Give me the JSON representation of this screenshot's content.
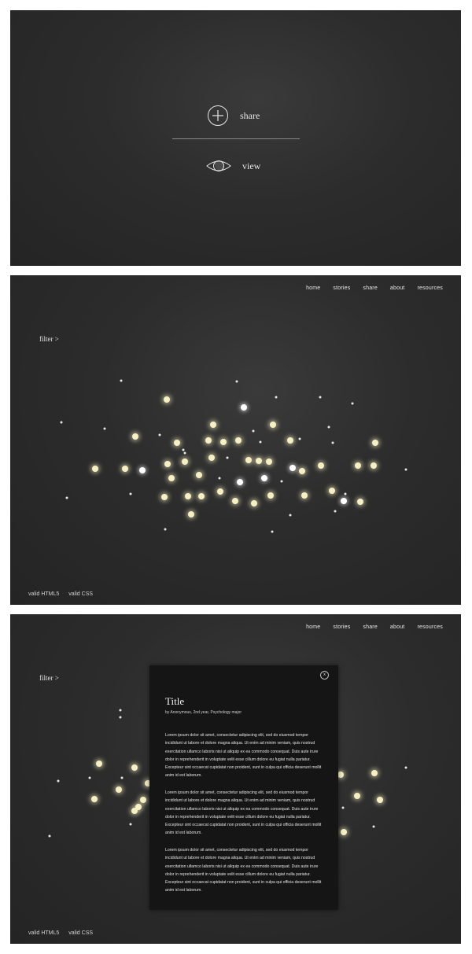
{
  "landing": {
    "share_label": "share",
    "view_label": "view"
  },
  "nav": [
    "home",
    "stories",
    "share",
    "about",
    "resources"
  ],
  "filter_label": "filter >",
  "footer": [
    "valid HTML5",
    "valid CSS"
  ],
  "modal": {
    "close_label": "x",
    "title": "Title",
    "byline": "by Anonymous, 2nd year, Psychology major",
    "paragraphs": [
      "Lorem ipsum dolor sit amet, consectetur adipiscing elit, sed do eiusmod tempor incididunt ut labore et dolore magna aliqua. Ut enim ad minim veniam, quis nostrud exercitation ullamco laboris nisi ut aliquip ex ea commodo consequat. Duis aute irure dolor in reprehenderit in voluptate velit esse cillum dolore eu fugiat nulla pariatur. Excepteur sint occaecat cupidatat non proident, sunt in culpa qui officia deserunt mollit anim id est laborum.",
      "Lorem ipsum dolor sit amet, consectetur adipiscing elit, sed do eiusmod tempor incididunt ut labore et dolore magna aliqua. Ut enim ad minim veniam, quis nostrud exercitation ullamco laboris nisi ut aliquip ex ea commodo consequat. Duis aute irure dolor in reprehenderit in voluptate velit esse cillum dolore eu fugiat nulla pariatur. Excepteur sint occaecat cupidatat non proident, sunt in culpa qui officia deserunt mollit anim id est laborum.",
      "Lorem ipsum dolor sit amet, consectetur adipiscing elit, sed do eiusmod tempor incididunt ut labore et dolore magna aliqua. Ut enim ad minim veniam, quis nostrud exercitation ullamco laboris nisi ut aliquip ex ea commodo consequat. Duis aute irure dolor in reprehenderit in voluptate velit esse cillum dolore eu fugiat nulla pariatur. Excepteur sint occaecat cupidatat non proident, sunt in culpa qui officia deserunt mollit anim id est laborum."
    ]
  },
  "colors": {
    "background": "#2c2c2c",
    "story_glow": "#f6f0c2",
    "story_white": "#ffffff",
    "modal_bg": "#151515"
  },
  "icons": [
    "plus-circle-icon",
    "eye-icon",
    "close-icon"
  ]
}
